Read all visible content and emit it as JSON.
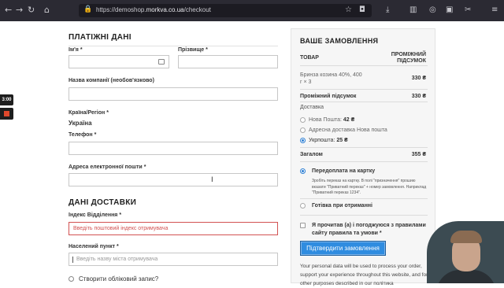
{
  "browser": {
    "url_host": "https://demoshop.",
    "url_domain": "morkva.co.ua",
    "url_path": "/checkout"
  },
  "recorder": {
    "time": "3:00"
  },
  "billing": {
    "title": "ПЛАТІЖНІ ДАНІ",
    "first_name_label": "Ім'я",
    "last_name_label": "Прізвище",
    "company_label": "Назва компанії (необов'язково)",
    "country_label": "Країна/Регіон",
    "country_value": "Україна",
    "phone_label": "Телефон",
    "email_label": "Адреса електронної пошти",
    "required_mark": "*"
  },
  "shipping": {
    "title": "ДАНІ ДОСТАВКИ",
    "postcode_label": "Індекс Відділення",
    "postcode_placeholder": "Введіть поштовий індекс отримувача",
    "city_label": "Населений пункт",
    "city_placeholder": "Введіть назву міста отримувача",
    "create_account_label": "Створити обліковий запис?"
  },
  "order": {
    "title": "ВАШЕ ЗАМОВЛЕННЯ",
    "col_product": "ТОВАР",
    "col_subtotal_line1": "ПРОМІЖНИЙ",
    "col_subtotal_line2": "ПІДСУМОК",
    "item_name_line1": "Бринза козина 40%, 400",
    "item_name_line2": "г × 3",
    "item_price": "330 ₴",
    "subtotal_label": "Проміжний підсумок",
    "subtotal_value": "330 ₴",
    "delivery_label": "Доставка",
    "delivery_options": [
      {
        "label": "Нова Пошта: ",
        "price": "42 ₴",
        "selected": false
      },
      {
        "label": "Адресна доставка Нова пошта",
        "price": "",
        "selected": false
      },
      {
        "label": "Укрпошта: ",
        "price": "25 ₴",
        "selected": true
      }
    ],
    "total_label": "Загалом",
    "total_value": "355 ₴",
    "payment_card_label": "Передоплата на картку",
    "payment_note": "Зробіть переказ на картку. В полі \"призначення\" прошию вказати \"Приватний переказ\" + номер замовлення. Наприклад \"Приватний переказ 1234\".",
    "payment_cod_label": "Готівка при отриманні",
    "terms_line1": "Я прочитав (а) і погоджуюся з правилами",
    "terms_line2": "сайту правила та умови",
    "terms_req": "*",
    "confirm_button": "Підтвердити замовлення",
    "privacy_text": "Your personal data will be used to process your order, support your experience throughout this website, and for other purposes described in our політика"
  }
}
